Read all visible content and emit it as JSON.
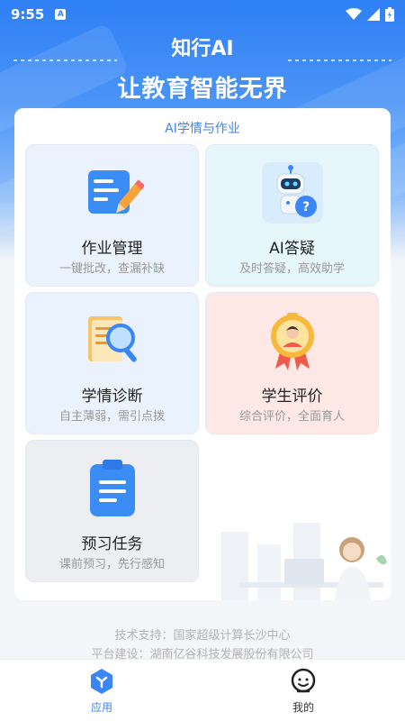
{
  "status_bar": {
    "time": "9:55",
    "notification_glyph": "A"
  },
  "header": {
    "title": "知行AI",
    "slogan": "让教育智能无界"
  },
  "panel": {
    "title": "AI学情与作业",
    "cards": [
      {
        "name": "作业管理",
        "desc": "一键批改，查漏补缺",
        "icon": "notepad-pencil-icon"
      },
      {
        "name": "AI答疑",
        "desc": "及时答疑，高效助学",
        "icon": "robot-question-icon"
      },
      {
        "name": "学情诊断",
        "desc": "自主薄弱，需引点拨",
        "icon": "magnifier-document-icon"
      },
      {
        "name": "学生评价",
        "desc": "综合评价，全面育人",
        "icon": "medal-badge-icon"
      },
      {
        "name": "预习任务",
        "desc": "课前预习，先行感知",
        "icon": "clipboard-icon"
      }
    ]
  },
  "footer": {
    "support": "技术支持：国家超级计算长沙中心",
    "builder": "平台建设：湖南亿谷科技发展股份有限公司"
  },
  "tabbar": {
    "tabs": [
      {
        "label": "应用",
        "active": true
      },
      {
        "label": "我的",
        "active": false
      }
    ]
  },
  "colors": {
    "accent": "#3b86f6",
    "card_blue_bg": "#e9f2fd",
    "card_cyan_bg": "#e6f7fb",
    "card_pink_bg": "#fde8e6",
    "card_gray_bg": "#eceef2"
  }
}
